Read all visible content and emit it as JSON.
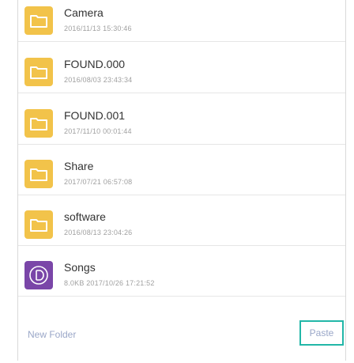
{
  "colors": {
    "folder_icon": "#f2c34a",
    "music_icon": "#7a46a8",
    "highlight_border": "#22b7a8",
    "footer_text": "#9aa7c8"
  },
  "files": [
    {
      "name": "Camera",
      "meta": "2016/11/13 15:30:46",
      "icon": "folder-icon"
    },
    {
      "name": "FOUND.000",
      "meta": "2016/08/03 23:43:34",
      "icon": "folder-icon"
    },
    {
      "name": "FOUND.001",
      "meta": "2017/11/10 00:01:44",
      "icon": "folder-icon"
    },
    {
      "name": "Share",
      "meta": "2017/07/21 06:57:08",
      "icon": "folder-icon"
    },
    {
      "name": "software",
      "meta": "2016/08/13 23:04:26",
      "icon": "folder-icon"
    },
    {
      "name": "Songs",
      "meta": "8.0KB 2017/10/26 17:21:52",
      "icon": "music-icon"
    }
  ],
  "footer": {
    "new_folder_label": "New Folder",
    "paste_label": "Paste"
  }
}
